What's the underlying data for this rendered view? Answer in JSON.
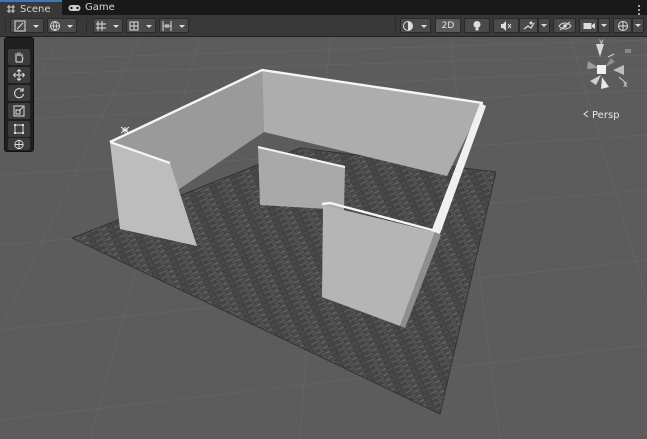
{
  "tabs": [
    {
      "label": "Scene",
      "icon": "hash-icon",
      "active": true
    },
    {
      "label": "Game",
      "icon": "gamepad-icon",
      "active": false
    }
  ],
  "toolbar": {
    "mode_2d_label": "2D"
  },
  "overlay": {
    "persp_label": "Persp",
    "gizmo_axes": {
      "y": "y",
      "x": "x"
    }
  },
  "tools": [
    "view-tool",
    "move-tool",
    "rotate-tool",
    "scale-tool",
    "rect-tool",
    "transform-tool"
  ]
}
